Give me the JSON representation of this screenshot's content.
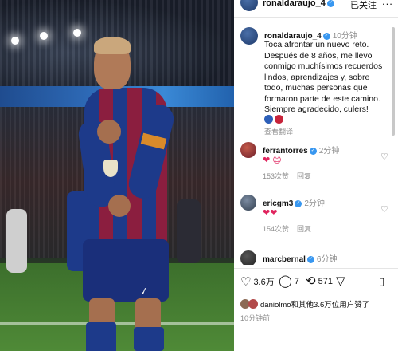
{
  "photo": {
    "banner_text": "",
    "jersey_brand": "✓"
  },
  "header": {
    "username": "ronaldaraujo_4",
    "follow_state": "已关注",
    "more": "..."
  },
  "caption": {
    "username": "ronaldaraujo_4",
    "time": "10分钟",
    "text": "Toca afrontar un nuevo reto. Después de 8 años, me llevo conmigo muchísimos recuerdos lindos, aprendizajes y, sobre todo, muchas personas que formaron parte de este camino. Siempre agradecido, culers!",
    "translate": "查看翻译"
  },
  "comments": [
    {
      "username": "ferrantorres",
      "time": "2分钟",
      "body": "❤",
      "likes": "153次赞",
      "reply": "回复"
    },
    {
      "username": "ericgm3",
      "time": "2分钟",
      "body": "❤❤",
      "likes": "154次赞",
      "reply": "回复"
    },
    {
      "username": "marcbernal",
      "time": "6分钟",
      "body": "",
      "likes": "",
      "reply": ""
    }
  ],
  "actions": {
    "likes_count": "3.6万",
    "comments_count": "7",
    "shares_count": "571"
  },
  "likes_line": "daniolmo和其他3.6万位用户赞了",
  "posted_time": "10分钟前",
  "colors": {
    "verified": "#3897f0",
    "heart": "#e0245e",
    "barca_blue": "#1d3a8a",
    "barca_red": "#8b1e3f"
  }
}
